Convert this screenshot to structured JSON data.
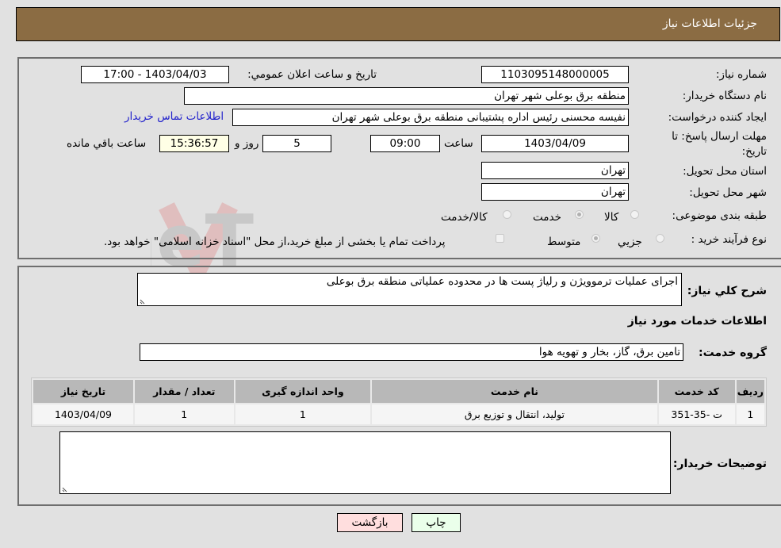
{
  "header": {
    "title": "جزئیات اطلاعات نیاز"
  },
  "form": {
    "need_number": {
      "label": "شماره نیاز:",
      "value": "1103095148000005"
    },
    "announce_datetime": {
      "label": "تاریخ و ساعت اعلان عمومي:",
      "value": "1403/04/03 - 17:00"
    },
    "buyer_org": {
      "label": "نام دستگاه خریدار:",
      "value": "منطقه برق بوعلی شهر تهران"
    },
    "requester": {
      "label": "ایجاد کننده درخواست:",
      "value": "نفیسه محسنی رئیس اداره پشتیبانی منطقه برق بوعلی شهر تهران"
    },
    "buyer_contact_link": "اطلاعات تماس خریدار",
    "deadline": {
      "label_line1": "مهلت ارسال پاسخ: تا",
      "label_line2": "تاریخ:",
      "date": "1403/04/09",
      "time_label": "ساعت",
      "time": "09:00",
      "days": "5",
      "days_label": "روز و",
      "remaining": "15:36:57",
      "remaining_label": "ساعت باقي مانده"
    },
    "province": {
      "label": "استان محل تحویل:",
      "value": "تهران"
    },
    "city": {
      "label": "شهر محل تحویل:",
      "value": "تهران"
    },
    "category": {
      "label": "طبقه بندی موضوعی:",
      "options": [
        {
          "label": "کالا",
          "selected": false
        },
        {
          "label": "خدمت",
          "selected": true
        },
        {
          "label": "کالا/خدمت",
          "selected": false
        }
      ]
    },
    "process": {
      "label": "نوع فرآیند خرید :",
      "options": [
        {
          "label": "جزيي",
          "selected": false
        },
        {
          "label": "متوسط",
          "selected": true
        }
      ],
      "treasury_note": "پرداخت تمام یا بخشی از مبلغ خرید،از محل \"اسناد خزانه اسلامی\" خواهد بود."
    }
  },
  "details": {
    "description_label": "شرح کلي نياز:",
    "description": "اجرای عملیات ترموویژن و رلیاژ پست ها در محدوده عملیاتی منطقه برق بوعلی",
    "services_title": "اطلاعات خدمات مورد نیاز",
    "service_group_label": "گروه خدمت:",
    "service_group": "تامین برق، گاز، بخار و تهویه هوا",
    "table": {
      "headers": [
        "ردیف",
        "کد خدمت",
        "نام خدمت",
        "واحد اندازه گیری",
        "تعداد / مقدار",
        "تاریخ نیاز"
      ],
      "rows": [
        [
          "1",
          "ت -35-351",
          "تولید، انتقال و توزیع برق",
          "1",
          "1",
          "1403/04/09"
        ]
      ]
    },
    "buyer_notes_label": "توضیحات خریدار:",
    "buyer_notes": ""
  },
  "buttons": {
    "print": "چاپ",
    "back": "بازگشت"
  },
  "watermark": "AriaTender.neT",
  "colors": {
    "header_bg": "#8b6c43",
    "link": "#2323cc",
    "back_btn": "#ffdede",
    "print_btn": "#eaffea",
    "remaining_bg": "#ffffe6"
  }
}
